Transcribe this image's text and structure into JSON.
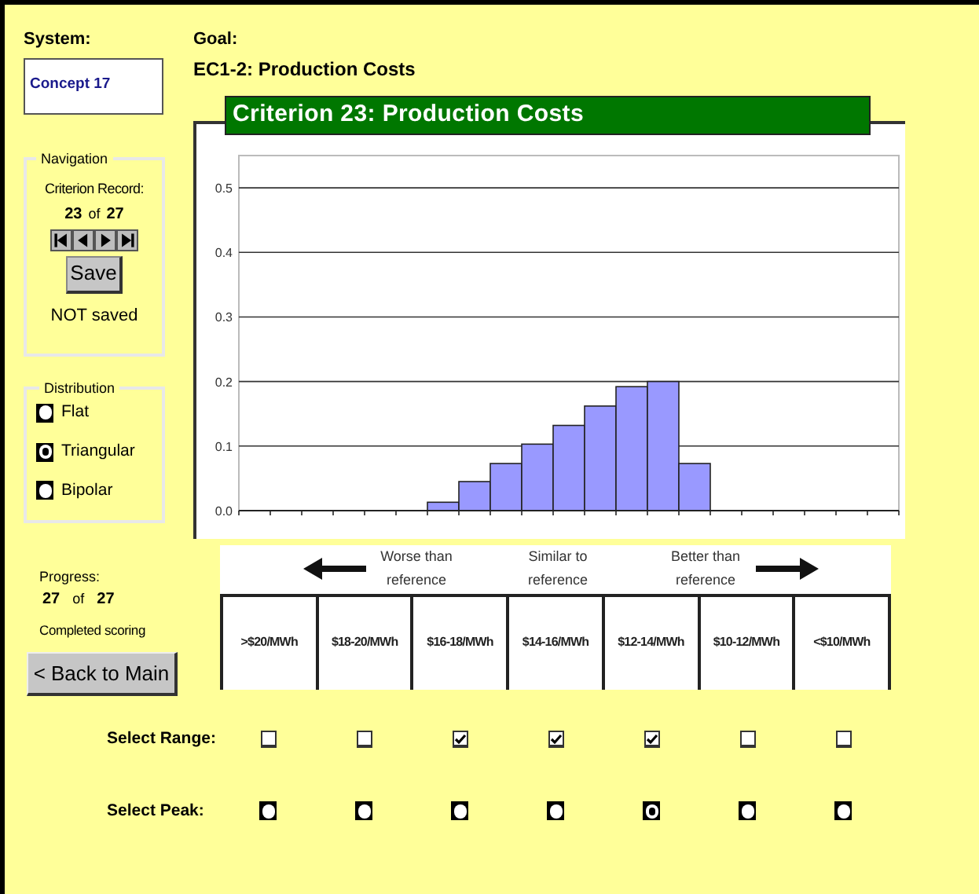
{
  "system": {
    "label": "System:",
    "value": "Concept 17"
  },
  "goal": {
    "label": "Goal:",
    "value": "EC1-2: Production Costs"
  },
  "navigation": {
    "legend": "Navigation",
    "record_label": "Criterion Record:",
    "current": "23",
    "of": "of",
    "total": "27",
    "save_button": "Save",
    "save_status": "NOT saved"
  },
  "distribution": {
    "legend": "Distribution",
    "options": [
      {
        "label": "Flat",
        "selected": false
      },
      {
        "label": "Triangular",
        "selected": true
      },
      {
        "label": "Bipolar",
        "selected": false
      }
    ]
  },
  "progress": {
    "label": "Progress:",
    "current": "27",
    "of": "of",
    "total": "27",
    "status": "Completed scoring"
  },
  "back_button": "< Back to Main",
  "chart": {
    "title": "Criterion 23: Production Costs",
    "chart_data": {
      "type": "bar",
      "grid": true,
      "ylim": [
        0,
        0.55
      ],
      "yticks": [
        {
          "value": 0,
          "label": "0.0"
        },
        {
          "value": 0.1,
          "label": "0.1"
        },
        {
          "value": 0.2,
          "label": "0.2"
        },
        {
          "value": 0.3,
          "label": "0.3"
        },
        {
          "value": 0.4,
          "label": "0.4"
        },
        {
          "value": 0.5,
          "label": "0.5"
        }
      ],
      "series": [
        {
          "color": "#9999ff",
          "values": [
            0,
            0,
            0,
            0,
            0,
            0,
            0.013,
            0.045,
            0.073,
            0.103,
            0.132,
            0.162,
            0.192,
            0.2,
            0.073,
            0,
            0,
            0,
            0,
            0,
            0
          ]
        }
      ]
    }
  },
  "scale": {
    "hints": [
      {
        "text": "Worse than reference",
        "kind": "worse"
      },
      {
        "text": "Similar to reference",
        "kind": "similar"
      },
      {
        "text": "Better than reference",
        "kind": "better"
      }
    ],
    "columns": [
      ">$20/MWh",
      "$18-20/MWh",
      "$16-18/MWh",
      "$14-16/MWh",
      "$12-14/MWh",
      "$10-12/MWh",
      "<$10/MWh"
    ]
  },
  "select_range": {
    "label": "Select Range:",
    "items": [
      {
        "checked": false
      },
      {
        "checked": false
      },
      {
        "checked": true
      },
      {
        "checked": true
      },
      {
        "checked": true
      },
      {
        "checked": false
      },
      {
        "checked": false
      }
    ]
  },
  "select_peak": {
    "label": "Select Peak:",
    "items": [
      {
        "selected": false
      },
      {
        "selected": false
      },
      {
        "selected": false
      },
      {
        "selected": false
      },
      {
        "selected": true
      },
      {
        "selected": false
      },
      {
        "selected": false
      }
    ]
  }
}
